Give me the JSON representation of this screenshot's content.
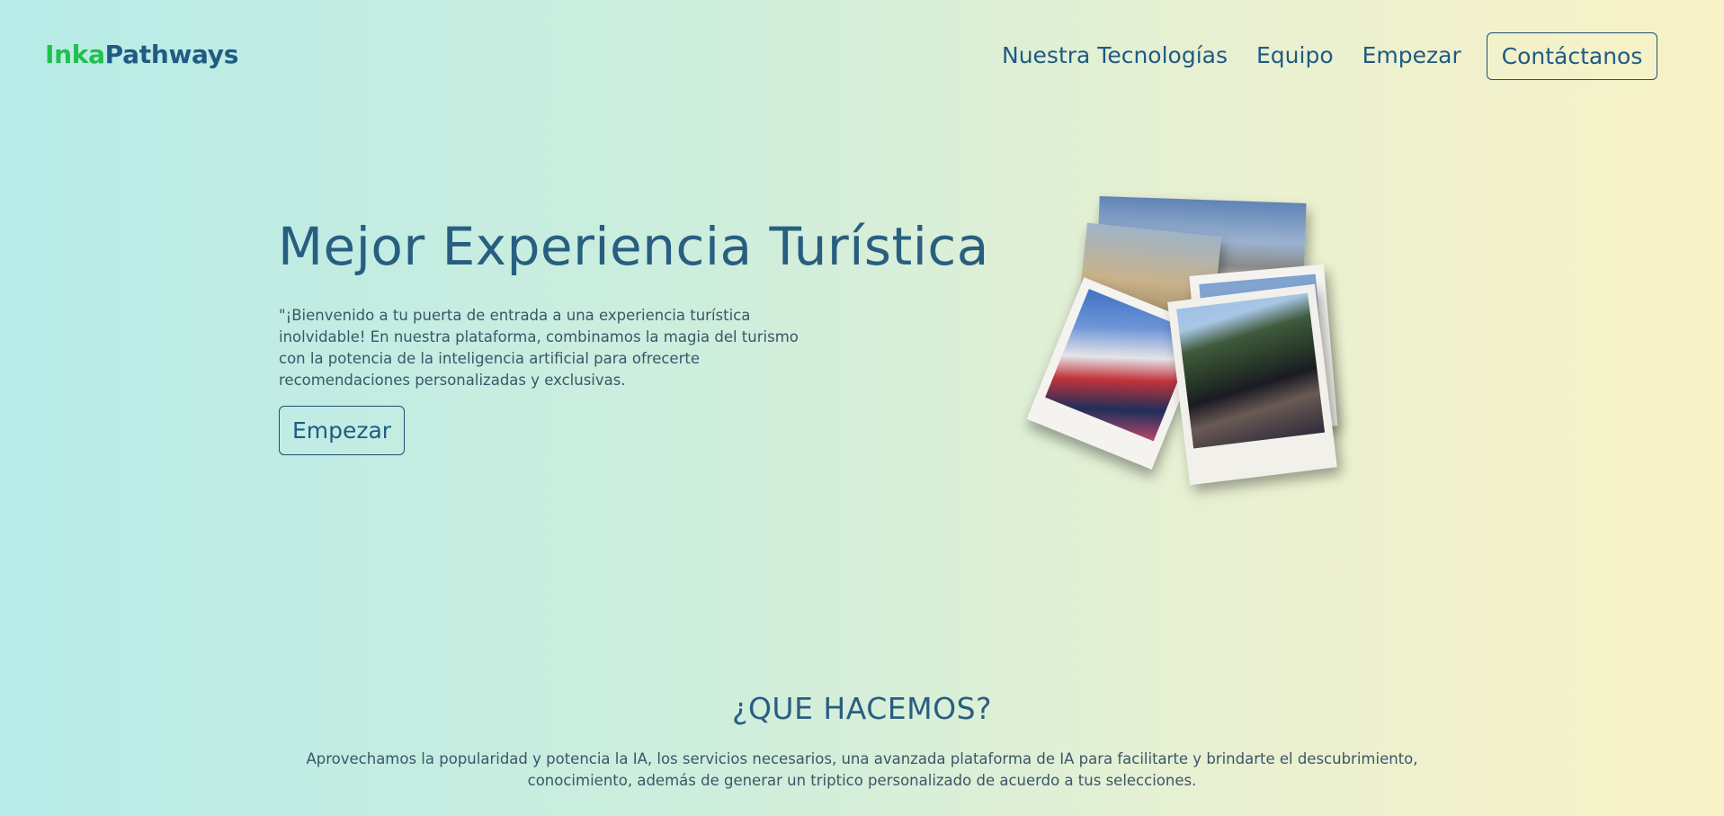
{
  "header": {
    "logo_part1": "Inka",
    "logo_part2": "Pathways",
    "nav": [
      "Nuestra Tecnologías",
      "Equipo",
      "Empezar"
    ],
    "contact_label": "Contáctanos"
  },
  "hero": {
    "title": "Mejor Experiencia Turística",
    "text": "\"¡Bienvenido a tu puerta de entrada a una experiencia turística inolvidable! En nuestra plataforma, combinamos la magia del turismo con la potencia de la inteligencia artificial para ofrecerte recomendaciones personalizadas y exclusivas.",
    "button_label": "Empezar"
  },
  "about": {
    "title": "¿QUE HACEMOS?",
    "text": "Aprovechamos la popularidad y potencia la IA, los servicios necesarios, una avanzada plataforma de IA para facilitarte y brindarte el descubrimiento, conocimiento, además de generar un triptico personalizado de acuerdo a tus selecciones."
  },
  "colors": {
    "logo_accent": "#1ec24a",
    "primary": "#1f5b83",
    "gradient_left": "#b7ebe8",
    "gradient_right": "#f8f2c6"
  }
}
